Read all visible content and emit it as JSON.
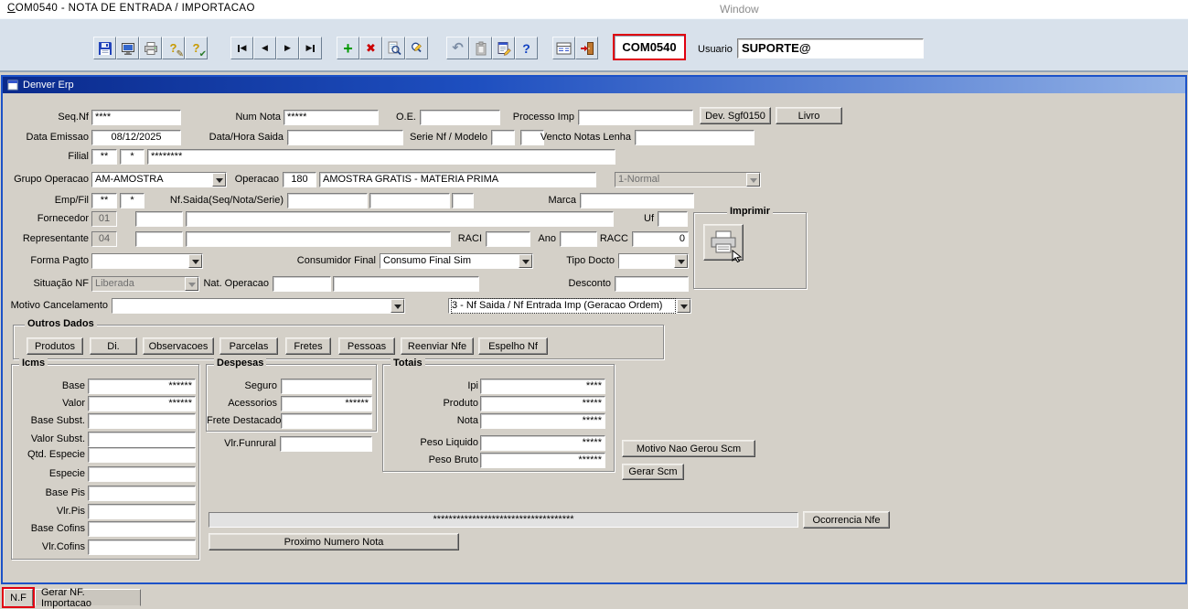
{
  "titlebar": {
    "title": "COM0540 - NOTA DE ENTRADA / IMPORTACAO",
    "window_caption": "Window"
  },
  "toolbar": {
    "program_code": "COM0540",
    "usuario_label": "Usuario",
    "usuario_value": "SUPORTE@",
    "glyphs": {
      "nav_prev": "◀",
      "nav_next": "▶",
      "add": "+",
      "delete": "✖",
      "undo": "↶",
      "help": "?",
      "query": "?",
      "pencil": "✎",
      "check": "✔"
    },
    "icon_names": [
      "save-icon",
      "monitor-icon",
      "print-icon",
      "enter-query-icon",
      "execute-query-icon",
      "nav-first-icon",
      "nav-prev-icon",
      "nav-next-icon",
      "nav-last-icon",
      "add-record-icon",
      "delete-record-icon",
      "search-form-icon",
      "search-edit-icon",
      "undo-icon",
      "paste-icon",
      "edit-form-icon",
      "help-icon",
      "list-icon",
      "exit-icon"
    ]
  },
  "app": {
    "title": "Denver Erp"
  },
  "form": {
    "seq_nf": {
      "label": "Seq.Nf",
      "value": "****"
    },
    "num_nota": {
      "label": "Num Nota",
      "value": "*****"
    },
    "oe": {
      "label": "O.E.",
      "value": ""
    },
    "processo_imp": {
      "label": "Processo Imp",
      "value": ""
    },
    "dev_sgf0150_button": "Dev. Sgf0150",
    "livro_button": "Livro",
    "data_emissao": {
      "label": "Data Emissao",
      "value": "08/12/2025"
    },
    "data_hora_saida": {
      "label": "Data/Hora Saida",
      "value": ""
    },
    "serie_nf_modelo": {
      "label": "Serie Nf / Modelo",
      "value1": "",
      "value2": ""
    },
    "vencto_notas_lenha": {
      "label": "Vencto Notas Lenha",
      "value": ""
    },
    "filial": {
      "label": "Filial",
      "value1": "**",
      "value2": "*",
      "value3": "********"
    },
    "grupo_operacao": {
      "label": "Grupo Operacao",
      "value": "AM-AMOSTRA"
    },
    "operacao": {
      "label": "Operacao",
      "code": "180",
      "desc": "AMOSTRA GRATIS - MATERIA PRIMA"
    },
    "tipo_nota": {
      "value": "1-Normal"
    },
    "emp_fil": {
      "label": "Emp/Fil",
      "value1": "**",
      "value2": "*"
    },
    "nf_saida": {
      "label": "Nf.Saida(Seq/Nota/Serie)",
      "value1": "",
      "value2": "",
      "value3": ""
    },
    "marca": {
      "label": "Marca",
      "value": ""
    },
    "fornecedor": {
      "label": "Fornecedor",
      "code": "01",
      "value2": "",
      "desc": ""
    },
    "uf": {
      "label": "Uf",
      "value": ""
    },
    "representante": {
      "label": "Representante",
      "code": "04",
      "value2": "",
      "desc": ""
    },
    "raci": {
      "label": "RACI",
      "value": ""
    },
    "ano": {
      "label": "Ano",
      "value": ""
    },
    "racc": {
      "label": "RACC",
      "value": "0"
    },
    "forma_pagto": {
      "label": "Forma Pagto",
      "value": ""
    },
    "consumidor_final": {
      "label": "Consumidor Final",
      "value": "Consumo Final Sim"
    },
    "tipo_docto": {
      "label": "Tipo Docto",
      "value": ""
    },
    "situacao_nf": {
      "label": "Situação NF",
      "value": "Liberada"
    },
    "nat_operacao": {
      "label": "Nat. Operacao",
      "value1": "",
      "value2": ""
    },
    "desconto": {
      "label": "Desconto",
      "value": ""
    },
    "motivo_cancelamento": {
      "label": "Motivo Cancelamento",
      "value": ""
    },
    "nf_geracao": {
      "value": "3 - Nf Saida / Nf Entrada Imp (Geracao Ordem)"
    }
  },
  "imprimir": {
    "title": "Imprimir"
  },
  "outros_dados": {
    "title": "Outros Dados",
    "buttons": [
      "Produtos",
      "Di.",
      "Observacoes",
      "Parcelas",
      "Fretes",
      "Pessoas",
      "Reenviar Nfe",
      "Espelho Nf"
    ]
  },
  "icms": {
    "title": "Icms",
    "rows": [
      {
        "label": "Base",
        "value": "******"
      },
      {
        "label": "Valor",
        "value": "******"
      },
      {
        "label": "Base Subst.",
        "value": ""
      },
      {
        "label": "Valor Subst.",
        "value": ""
      },
      {
        "label": "Qtd. Especie",
        "value": ""
      },
      {
        "label": "Especie",
        "value": ""
      },
      {
        "label": "Base  Pis",
        "value": ""
      },
      {
        "label": "Vlr.Pis",
        "value": ""
      },
      {
        "label": "Base  Cofins",
        "value": ""
      },
      {
        "label": "Vlr.Cofins",
        "value": ""
      }
    ]
  },
  "despesas": {
    "title": "Despesas",
    "rows": [
      {
        "label": "Seguro",
        "value": ""
      },
      {
        "label": "Acessorios",
        "value": "******"
      },
      {
        "label": "Frete Destacado",
        "value": ""
      }
    ],
    "funrural": {
      "label": "Vlr.Funrural",
      "value": ""
    }
  },
  "totais": {
    "title": "Totais",
    "rows": [
      {
        "label": "Ipi",
        "value": "****"
      },
      {
        "label": "Produto",
        "value": "*****"
      },
      {
        "label": "Nota",
        "value": "*****"
      },
      {
        "label": "Peso Liquido",
        "value": "*****"
      },
      {
        "label": "Peso Bruto",
        "value": "******"
      }
    ]
  },
  "actions": {
    "motivo_nao_gerou_scm": "Motivo Nao Gerou Scm",
    "gerar_scm": "Gerar Scm",
    "ocorrencia_value": "************************************",
    "ocorrencia_nfe": "Ocorrencia Nfe",
    "proximo_numero_nota": "Proximo Numero Nota"
  },
  "tabs": [
    {
      "label": "N.F"
    },
    {
      "label": "Gerar NF. Importacao"
    }
  ]
}
